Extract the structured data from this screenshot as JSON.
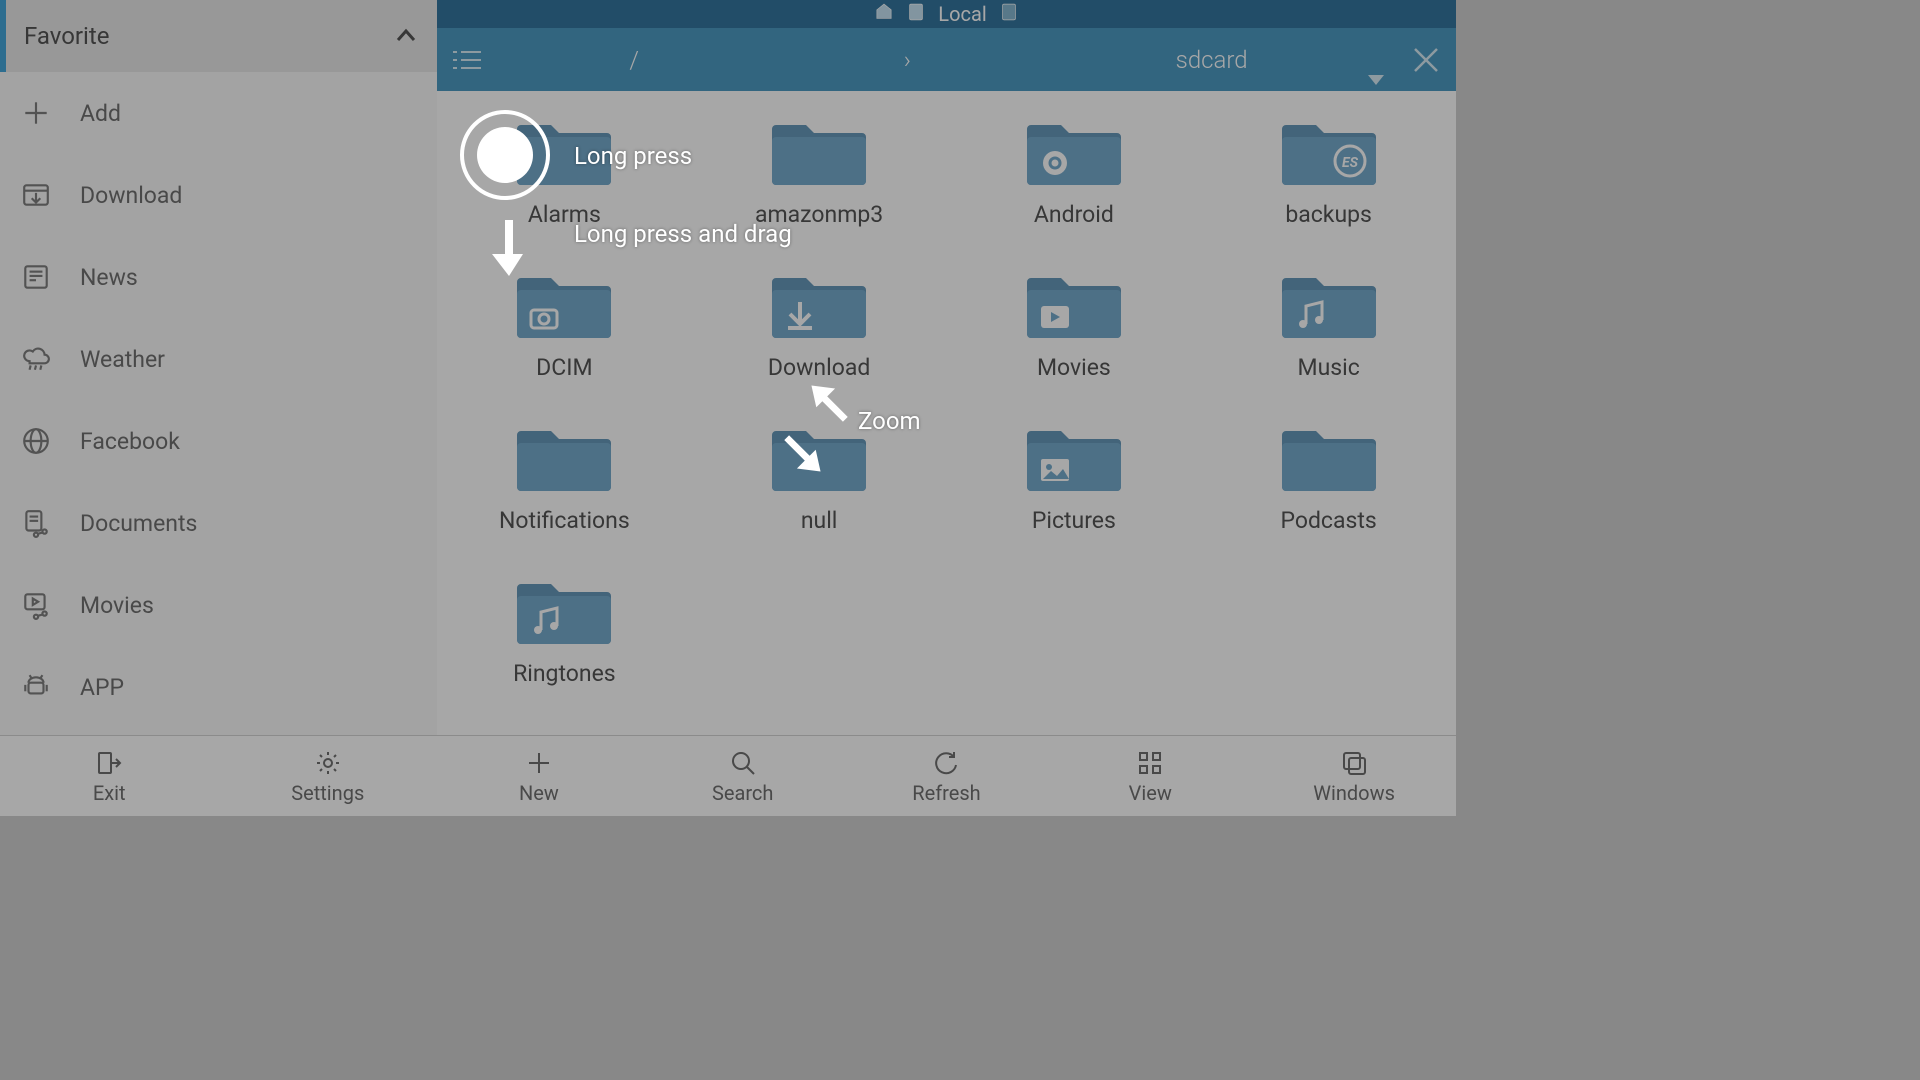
{
  "sidebar": {
    "header": "Favorite",
    "items": [
      {
        "label": "Add",
        "icon": "plus"
      },
      {
        "label": "Download",
        "icon": "download-box"
      },
      {
        "label": "News",
        "icon": "newspaper"
      },
      {
        "label": "Weather",
        "icon": "cloud-rain"
      },
      {
        "label": "Facebook",
        "icon": "globe"
      },
      {
        "label": "Documents",
        "icon": "doc-share"
      },
      {
        "label": "Movies",
        "icon": "movie-share"
      },
      {
        "label": "APP",
        "icon": "android"
      }
    ]
  },
  "topstatus": {
    "label": "Local"
  },
  "breadcrumb": {
    "seg0": "/",
    "seg1": "›",
    "seg2": "sdcard"
  },
  "folders": [
    {
      "name": "Alarms",
      "badge": "none"
    },
    {
      "name": "amazonmp3",
      "badge": "none"
    },
    {
      "name": "Android",
      "badge": "gear"
    },
    {
      "name": "backups",
      "badge": "es"
    },
    {
      "name": "DCIM",
      "badge": "camera"
    },
    {
      "name": "Download",
      "badge": "download"
    },
    {
      "name": "Movies",
      "badge": "play"
    },
    {
      "name": "Music",
      "badge": "music"
    },
    {
      "name": "Notifications",
      "badge": "none"
    },
    {
      "name": "null",
      "badge": "none"
    },
    {
      "name": "Pictures",
      "badge": "picture"
    },
    {
      "name": "Podcasts",
      "badge": "none"
    },
    {
      "name": "Ringtones",
      "badge": "music"
    }
  ],
  "bottombar": {
    "side": [
      {
        "label": "Exit",
        "icon": "exit"
      },
      {
        "label": "Settings",
        "icon": "gear"
      }
    ],
    "main": [
      {
        "label": "New",
        "icon": "plus"
      },
      {
        "label": "Search",
        "icon": "search"
      },
      {
        "label": "Refresh",
        "icon": "refresh"
      },
      {
        "label": "View",
        "icon": "grid"
      },
      {
        "label": "Windows",
        "icon": "windows"
      }
    ]
  },
  "tutorial": {
    "longpress": "Long press",
    "longdrag": "Long press and drag",
    "zoom": "Zoom"
  },
  "colors": {
    "folder": "#5b9bc4",
    "folder_dark": "#4a86ad",
    "accent": "#2a87b7"
  }
}
